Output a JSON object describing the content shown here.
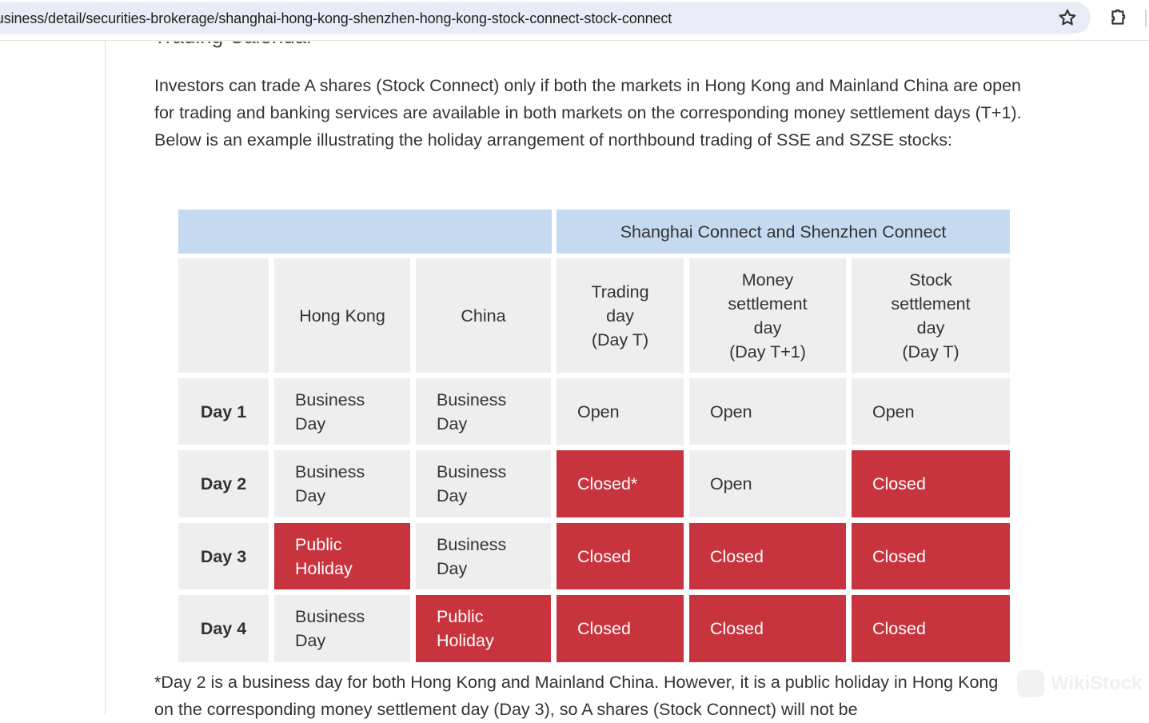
{
  "browser": {
    "url": "/business/detail/securities-brokerage/shanghai-hong-kong-shenzhen-hong-kong-stock-connect-stock-connect",
    "icons": [
      "bookmark-star-icon",
      "extensions-puzzle-icon"
    ]
  },
  "article": {
    "heading": "Trading Calendar",
    "intro": "Investors can trade A shares (Stock Connect) only if both the markets in Hong Kong and Mainland China are open for trading and banking services are available in both markets on the corresponding money settlement days (T+1). Below is an example illustrating the holiday arrangement of northbound trading of SSE and SZSE stocks:",
    "footnote": "*Day 2 is a business day for both Hong Kong and Mainland China. However, it is a public holiday in Hong Kong on the corresponding money settlement day (Day 3), so A shares (Stock Connect) will not be"
  },
  "table": {
    "group_header": "Shanghai Connect and Shenzhen Connect",
    "columns": [
      "",
      "Hong Kong",
      "China",
      "Trading\nday\n(Day T)",
      "Money\nsettlement\nday\n(Day T+1)",
      "Stock\nsettlement\nday\n(Day T)"
    ],
    "rows": [
      {
        "day": "Day 1",
        "hk": "Business Day",
        "china": "Business Day",
        "trading": "Open",
        "money": "Open",
        "stock": "Open"
      },
      {
        "day": "Day 2",
        "hk": "Business Day",
        "china": "Business Day",
        "trading": "Closed*",
        "money": "Open",
        "stock": "Closed"
      },
      {
        "day": "Day 3",
        "hk": "Public Holiday",
        "china": "Business Day",
        "trading": "Closed",
        "money": "Closed",
        "stock": "Closed"
      },
      {
        "day": "Day 4",
        "hk": "Business Day",
        "china": "Public Holiday",
        "trading": "Closed",
        "money": "Closed",
        "stock": "Closed"
      }
    ],
    "colors": {
      "header_blue": "#c5daf0",
      "cell_gray": "#eeeeee",
      "closed_red": "#c8343e"
    }
  },
  "watermark": "WikiStock"
}
